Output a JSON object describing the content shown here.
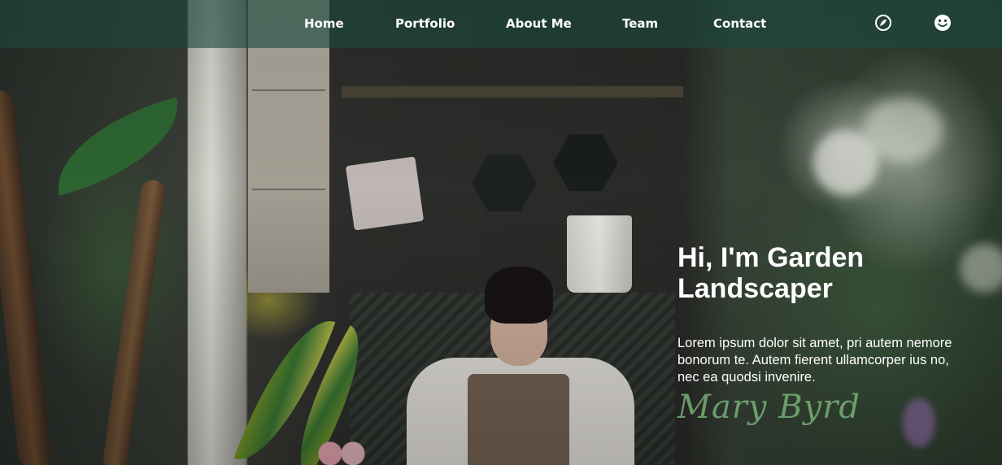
{
  "nav": {
    "items": [
      {
        "label": "Home"
      },
      {
        "label": "Portfolio"
      },
      {
        "label": "About Me"
      },
      {
        "label": "Team"
      },
      {
        "label": "Contact"
      }
    ],
    "icons": [
      "compass-icon",
      "smiley-icon"
    ]
  },
  "hero": {
    "title": "Hi, I'm Garden Landscaper",
    "description": "Lorem ipsum dolor sit amet, pri autem nemore bonorum te. Autem fierent ullamcorper ius no, nec ea quodsi invenire.",
    "signature": "Mary Byrd"
  },
  "colors": {
    "nav_background": "#1c483c",
    "signature": "#78af78",
    "text": "#ffffff"
  }
}
